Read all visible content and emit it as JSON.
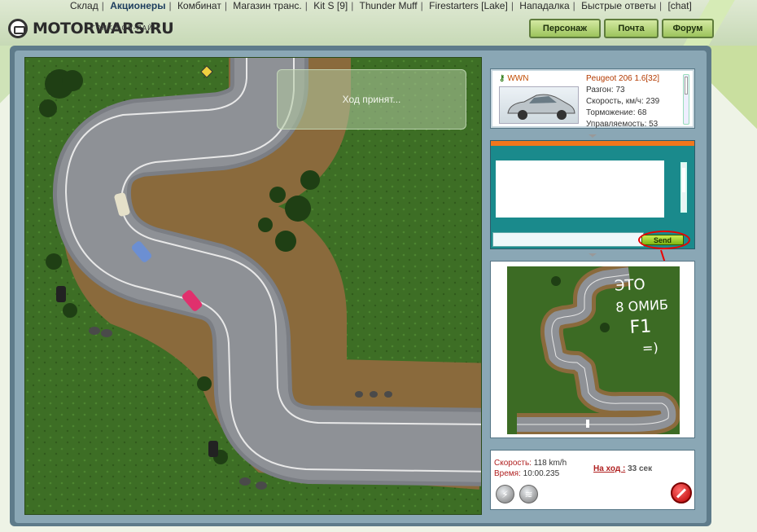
{
  "nav": {
    "items": [
      {
        "label": "Склад",
        "active": false
      },
      {
        "label": "Акционеры",
        "active": true
      },
      {
        "label": "Комбинат",
        "active": false
      },
      {
        "label": "Магазин транс.",
        "active": false
      },
      {
        "label": "Kit S [9]",
        "active": false
      },
      {
        "label": "Thunder Muff",
        "active": false
      },
      {
        "label": "Firestarters [Lake]",
        "active": false
      },
      {
        "label": "Нападалка",
        "active": false
      },
      {
        "label": "Быстрые ответы",
        "active": false
      },
      {
        "label": "[chat]",
        "active": false
      }
    ]
  },
  "logo": {
    "name": "MOTORWARS.RU",
    "subtitle": "ГОНКИ ОН-ЛАЙН"
  },
  "top_buttons": {
    "character": "Персонаж",
    "mail": "Почта",
    "forum": "Форум"
  },
  "map": {
    "message": "Ход принят..."
  },
  "car_panel": {
    "owner": "WWN",
    "model": "Peugeot 206 1.6[32]",
    "stats": [
      "Разгон: 73",
      "Скорость, км/ч: 239",
      "Торможение: 68",
      "Управляемость: 53"
    ]
  },
  "chat": {
    "send_label": "Send",
    "input_value": ""
  },
  "annotation": {
    "lines": [
      "ЭТО",
      "8 ОМИБ",
      "F1",
      "=)"
    ],
    "color": "#ffffff"
  },
  "status": {
    "speed_label": "Скорость:",
    "speed_value": "118 km/h",
    "time_label": "Время:",
    "time_value": "10:00.235",
    "turn_label": "На ход :",
    "turn_value": "33 сек"
  },
  "colors": {
    "accent_red": "#b02020",
    "frame": "#5e7b8a",
    "chat_bg": "#1a8a8c",
    "stripe": "#f2761c"
  }
}
